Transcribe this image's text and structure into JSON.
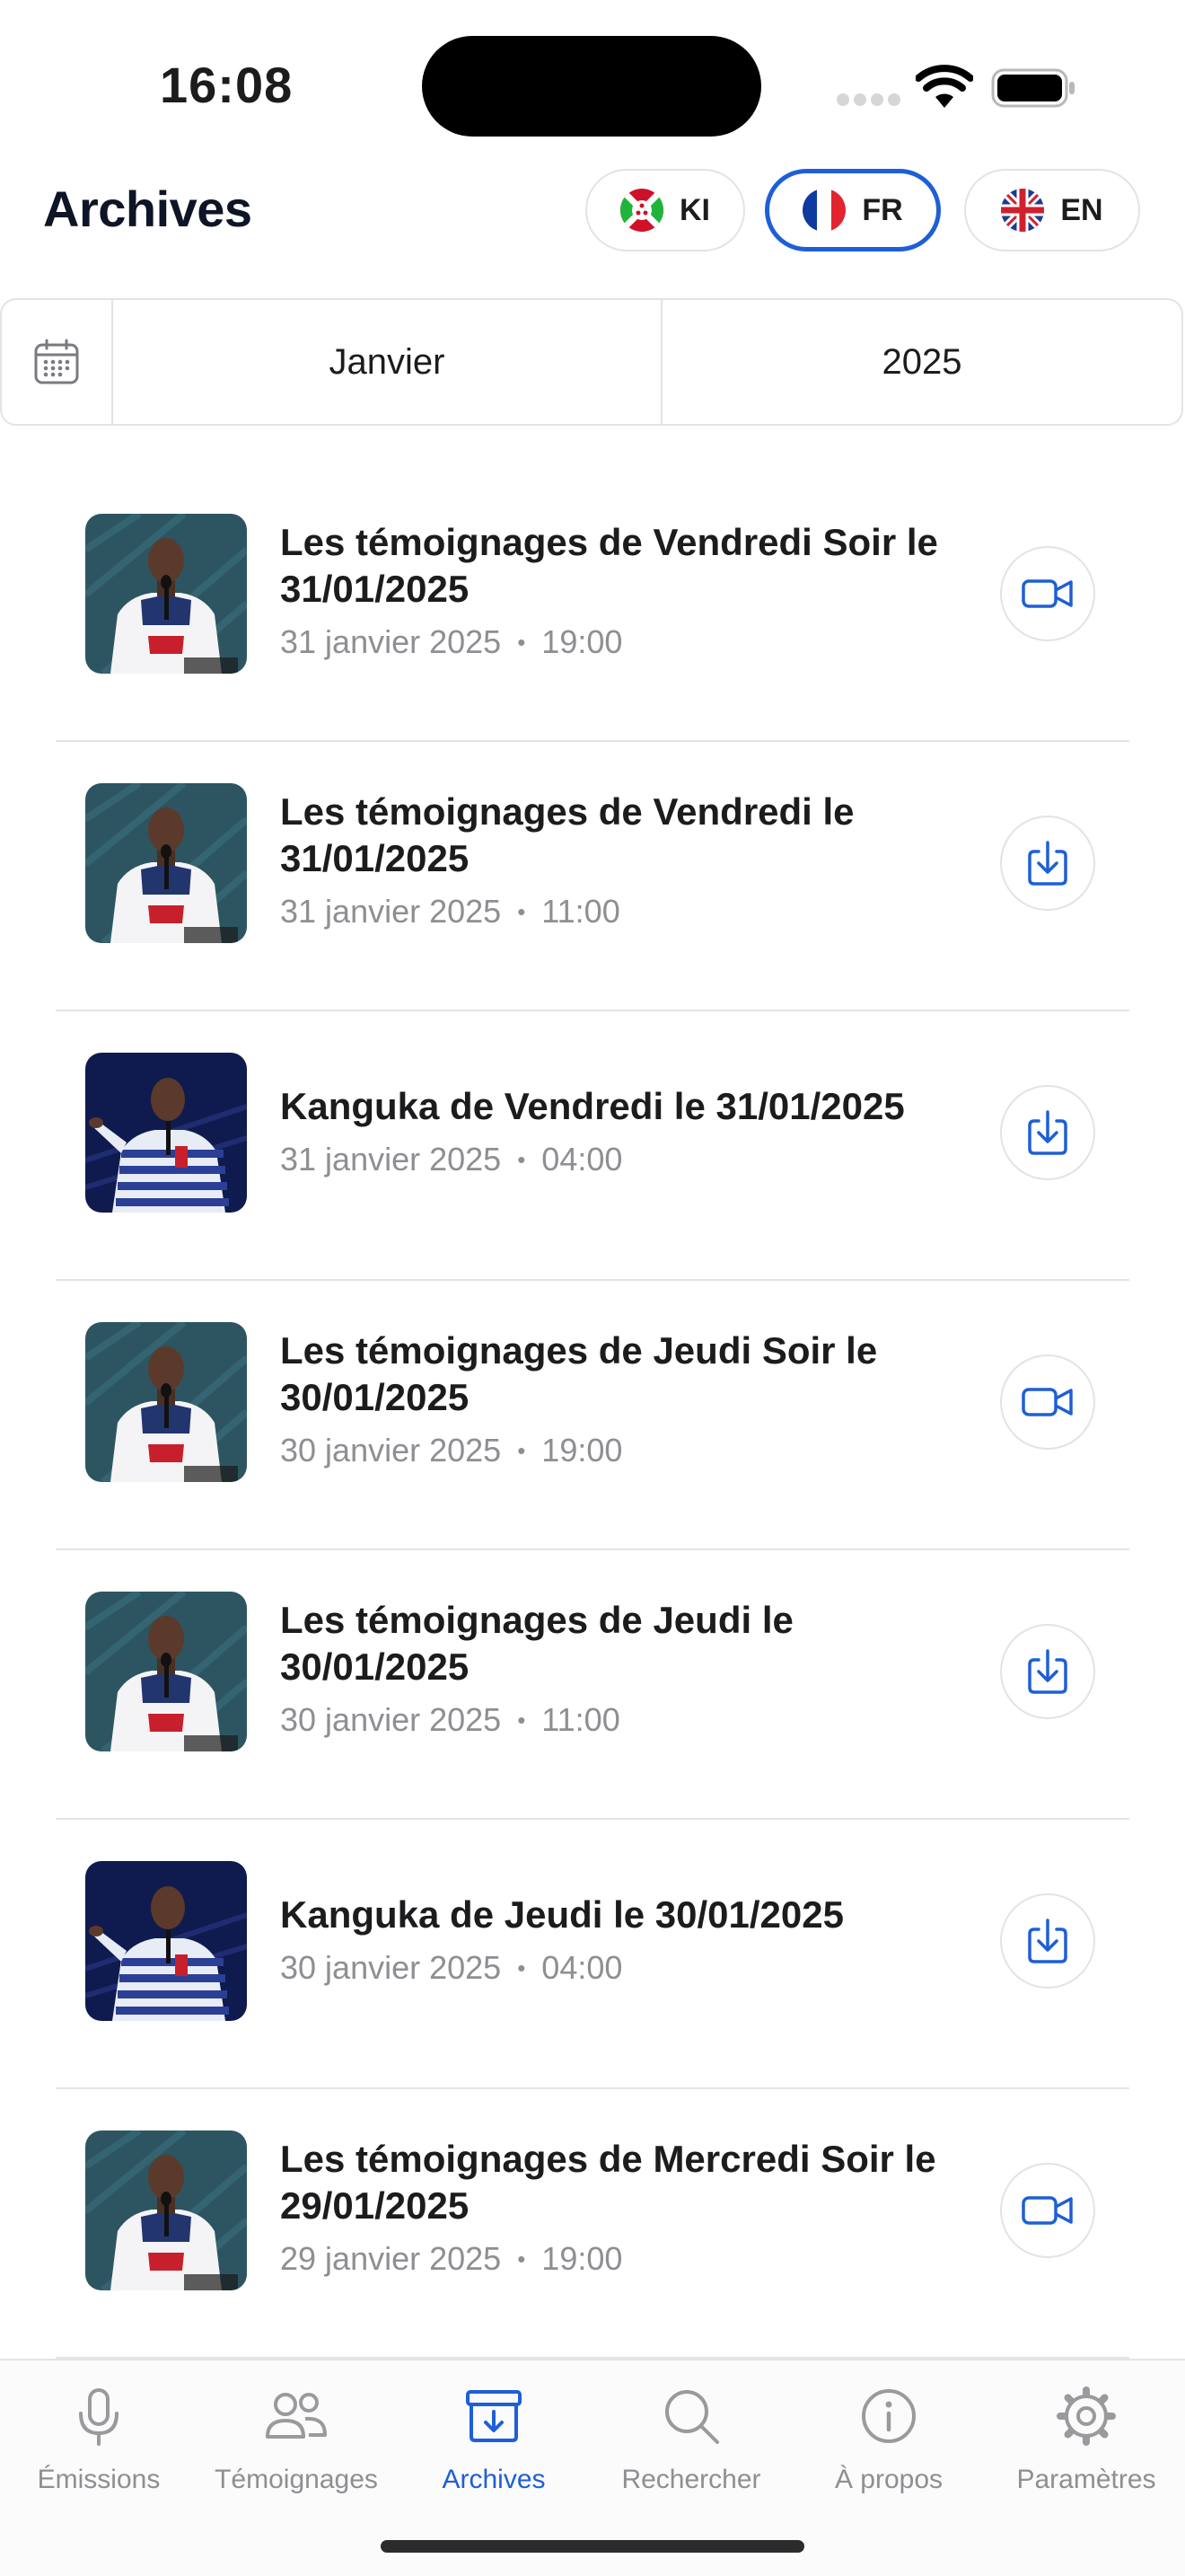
{
  "status_bar": {
    "time": "16:08"
  },
  "header": {
    "title": "Archives"
  },
  "languages": [
    {
      "code": "KI",
      "flag": "burundi-flag-icon",
      "active": false
    },
    {
      "code": "FR",
      "flag": "france-flag-icon",
      "active": true
    },
    {
      "code": "EN",
      "flag": "uk-flag-icon",
      "active": false
    }
  ],
  "filter": {
    "icon": "calendar-icon",
    "month": "Janvier",
    "year": "2025"
  },
  "items": [
    {
      "title": "Les témoignages de Vendredi Soir le 31/01/2025",
      "date": "31 janvier 2025",
      "time": "19:00",
      "action": "video-icon",
      "thumb": "speaker-thumbnail-a"
    },
    {
      "title": "Les témoignages de Vendredi le 31/01/2025",
      "date": "31 janvier 2025",
      "time": "11:00",
      "action": "download-icon",
      "thumb": "speaker-thumbnail-a"
    },
    {
      "title": "Kanguka de Vendredi le 31/01/2025",
      "date": "31 janvier 2025",
      "time": "04:00",
      "action": "download-icon",
      "thumb": "speaker-thumbnail-b"
    },
    {
      "title": "Les témoignages de Jeudi Soir le 30/01/2025",
      "date": "30 janvier 2025",
      "time": "19:00",
      "action": "video-icon",
      "thumb": "speaker-thumbnail-a"
    },
    {
      "title": "Les témoignages de Jeudi le 30/01/2025",
      "date": "30 janvier 2025",
      "time": "11:00",
      "action": "download-icon",
      "thumb": "speaker-thumbnail-a"
    },
    {
      "title": "Kanguka de Jeudi le 30/01/2025",
      "date": "30 janvier 2025",
      "time": "04:00",
      "action": "download-icon",
      "thumb": "speaker-thumbnail-b"
    },
    {
      "title": "Les témoignages de Mercredi Soir le 29/01/2025",
      "date": "29 janvier 2025",
      "time": "19:00",
      "action": "video-icon",
      "thumb": "speaker-thumbnail-a"
    }
  ],
  "tabs": [
    {
      "label": "Émissions",
      "icon": "microphone-icon",
      "active": false
    },
    {
      "label": "Témoignages",
      "icon": "people-icon",
      "active": false
    },
    {
      "label": "Archives",
      "icon": "archive-box-icon",
      "active": true
    },
    {
      "label": "Rechercher",
      "icon": "search-icon",
      "active": false
    },
    {
      "label": "À propos",
      "icon": "info-icon",
      "active": false
    },
    {
      "label": "Paramètres",
      "icon": "gear-icon",
      "active": false
    }
  ],
  "colors": {
    "accent": "#1e5fd6",
    "secondary_text": "#8e8e93",
    "divider": "#e4e4e7",
    "icon_gray": "#9a9a9e"
  }
}
